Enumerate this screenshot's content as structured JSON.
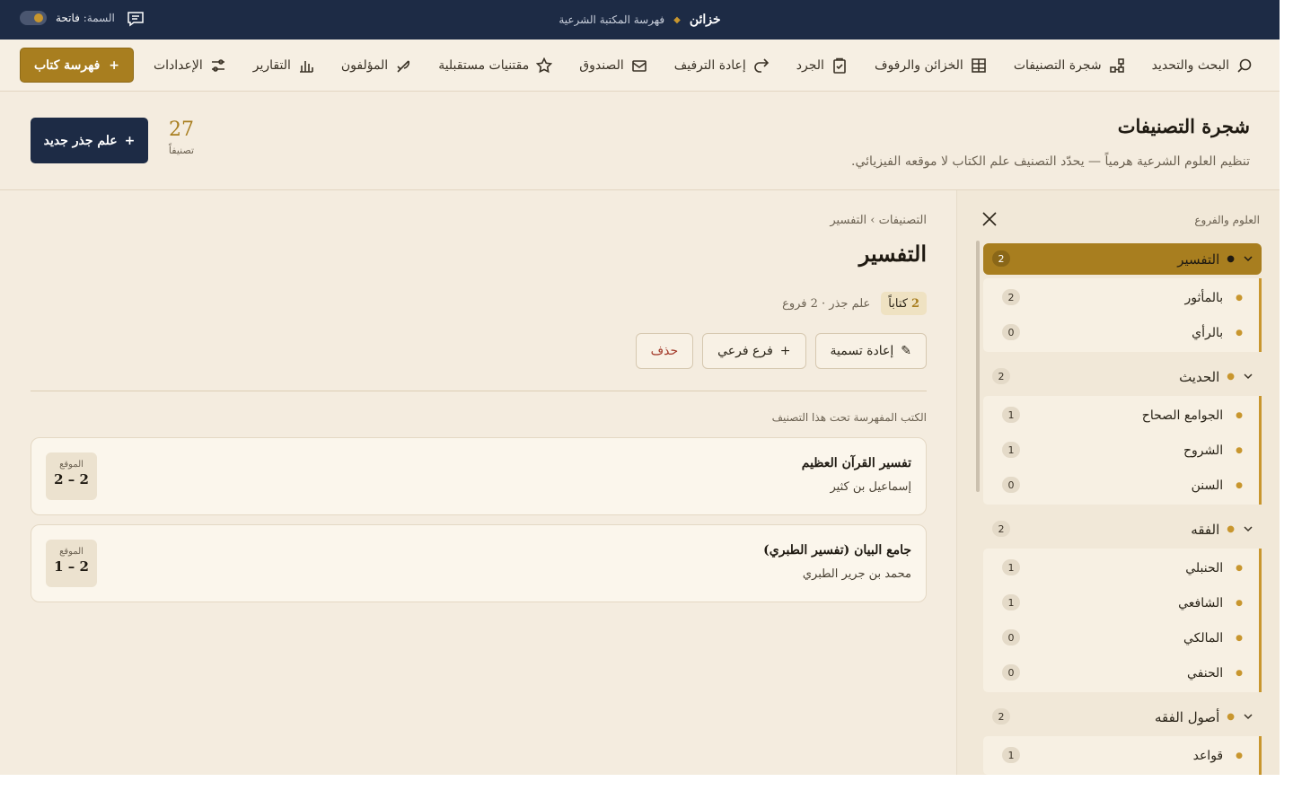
{
  "app": {
    "name": "خزائن",
    "subtitle": "فهرسة المكتبة الشرعية",
    "theme_label": "السمة:",
    "theme_value": "فاتحة"
  },
  "nav": {
    "items": [
      {
        "label": "البحث والتحديد",
        "icon": "search-icon"
      },
      {
        "label": "شجرة التصنيفات",
        "icon": "tree-icon"
      },
      {
        "label": "الخزائن والرفوف",
        "icon": "grid-icon"
      },
      {
        "label": "الجرد",
        "icon": "clipboard-icon"
      },
      {
        "label": "إعادة الترفيف",
        "icon": "redo-arrow-icon"
      },
      {
        "label": "الصندوق",
        "icon": "inbox-icon"
      },
      {
        "label": "مقتنيات مستقبلية",
        "icon": "star-icon"
      },
      {
        "label": "المؤلفون",
        "icon": "quill-icon"
      },
      {
        "label": "التقارير",
        "icon": "bar-chart-icon"
      },
      {
        "label": "الإعدادات",
        "icon": "sliders-icon"
      }
    ],
    "catalog_button": "فهرسة كتاب",
    "plus": "+"
  },
  "header": {
    "title": "شجرة التصنيفات",
    "subtitle": "تنظيم العلوم الشرعية هرمياً — يحدّد التصنيف علم الكتاب لا موقعه الفيزيائي.",
    "count": "27",
    "count_label": "تصنيفاً",
    "new_root_button": "علم جذر جديد"
  },
  "sidebar": {
    "title": "العلوم والفروع",
    "tree": [
      {
        "label": "التفسير",
        "count": "2",
        "active": true,
        "children": [
          {
            "label": "بالمأثور",
            "count": "2"
          },
          {
            "label": "بالرأي",
            "count": "0"
          }
        ]
      },
      {
        "label": "الحديث",
        "count": "2",
        "active": false,
        "children": [
          {
            "label": "الجوامع الصحاح",
            "count": "1"
          },
          {
            "label": "الشروح",
            "count": "1"
          },
          {
            "label": "السنن",
            "count": "0"
          }
        ]
      },
      {
        "label": "الفقه",
        "count": "2",
        "active": false,
        "children": [
          {
            "label": "الحنبلي",
            "count": "1"
          },
          {
            "label": "الشافعي",
            "count": "1"
          },
          {
            "label": "المالكي",
            "count": "0"
          },
          {
            "label": "الحنفي",
            "count": "0"
          }
        ]
      },
      {
        "label": "أصول الفقه",
        "count": "2",
        "active": false,
        "children": [
          {
            "label": "قواعد",
            "count": "1"
          }
        ]
      }
    ]
  },
  "main": {
    "breadcrumb": "التصنيفات › التفسير",
    "title": "التفسير",
    "books_count": "2",
    "books_word": "كتاباً",
    "meta": "علم جذر · 2 فروع",
    "rename_button": "إعادة تسمية",
    "rename_icon": "✎",
    "subbranch_button": "فرع فرعي",
    "delete_button": "حذف",
    "section_label": "الكتب المفهرسة تحت هذا التصنيف",
    "location_label": "الموقع",
    "books": [
      {
        "title": "تفسير القرآن العظيم",
        "author": "إسماعيل بن كثير",
        "location": "2 – 2"
      },
      {
        "title": "جامع البيان (تفسير الطبري)",
        "author": "محمد بن جرير الطبري",
        "location": "1 – 2"
      }
    ]
  },
  "colors": {
    "navy": "#1d2b45",
    "gold": "#a87e1f",
    "cream": "#f4ecdf"
  }
}
